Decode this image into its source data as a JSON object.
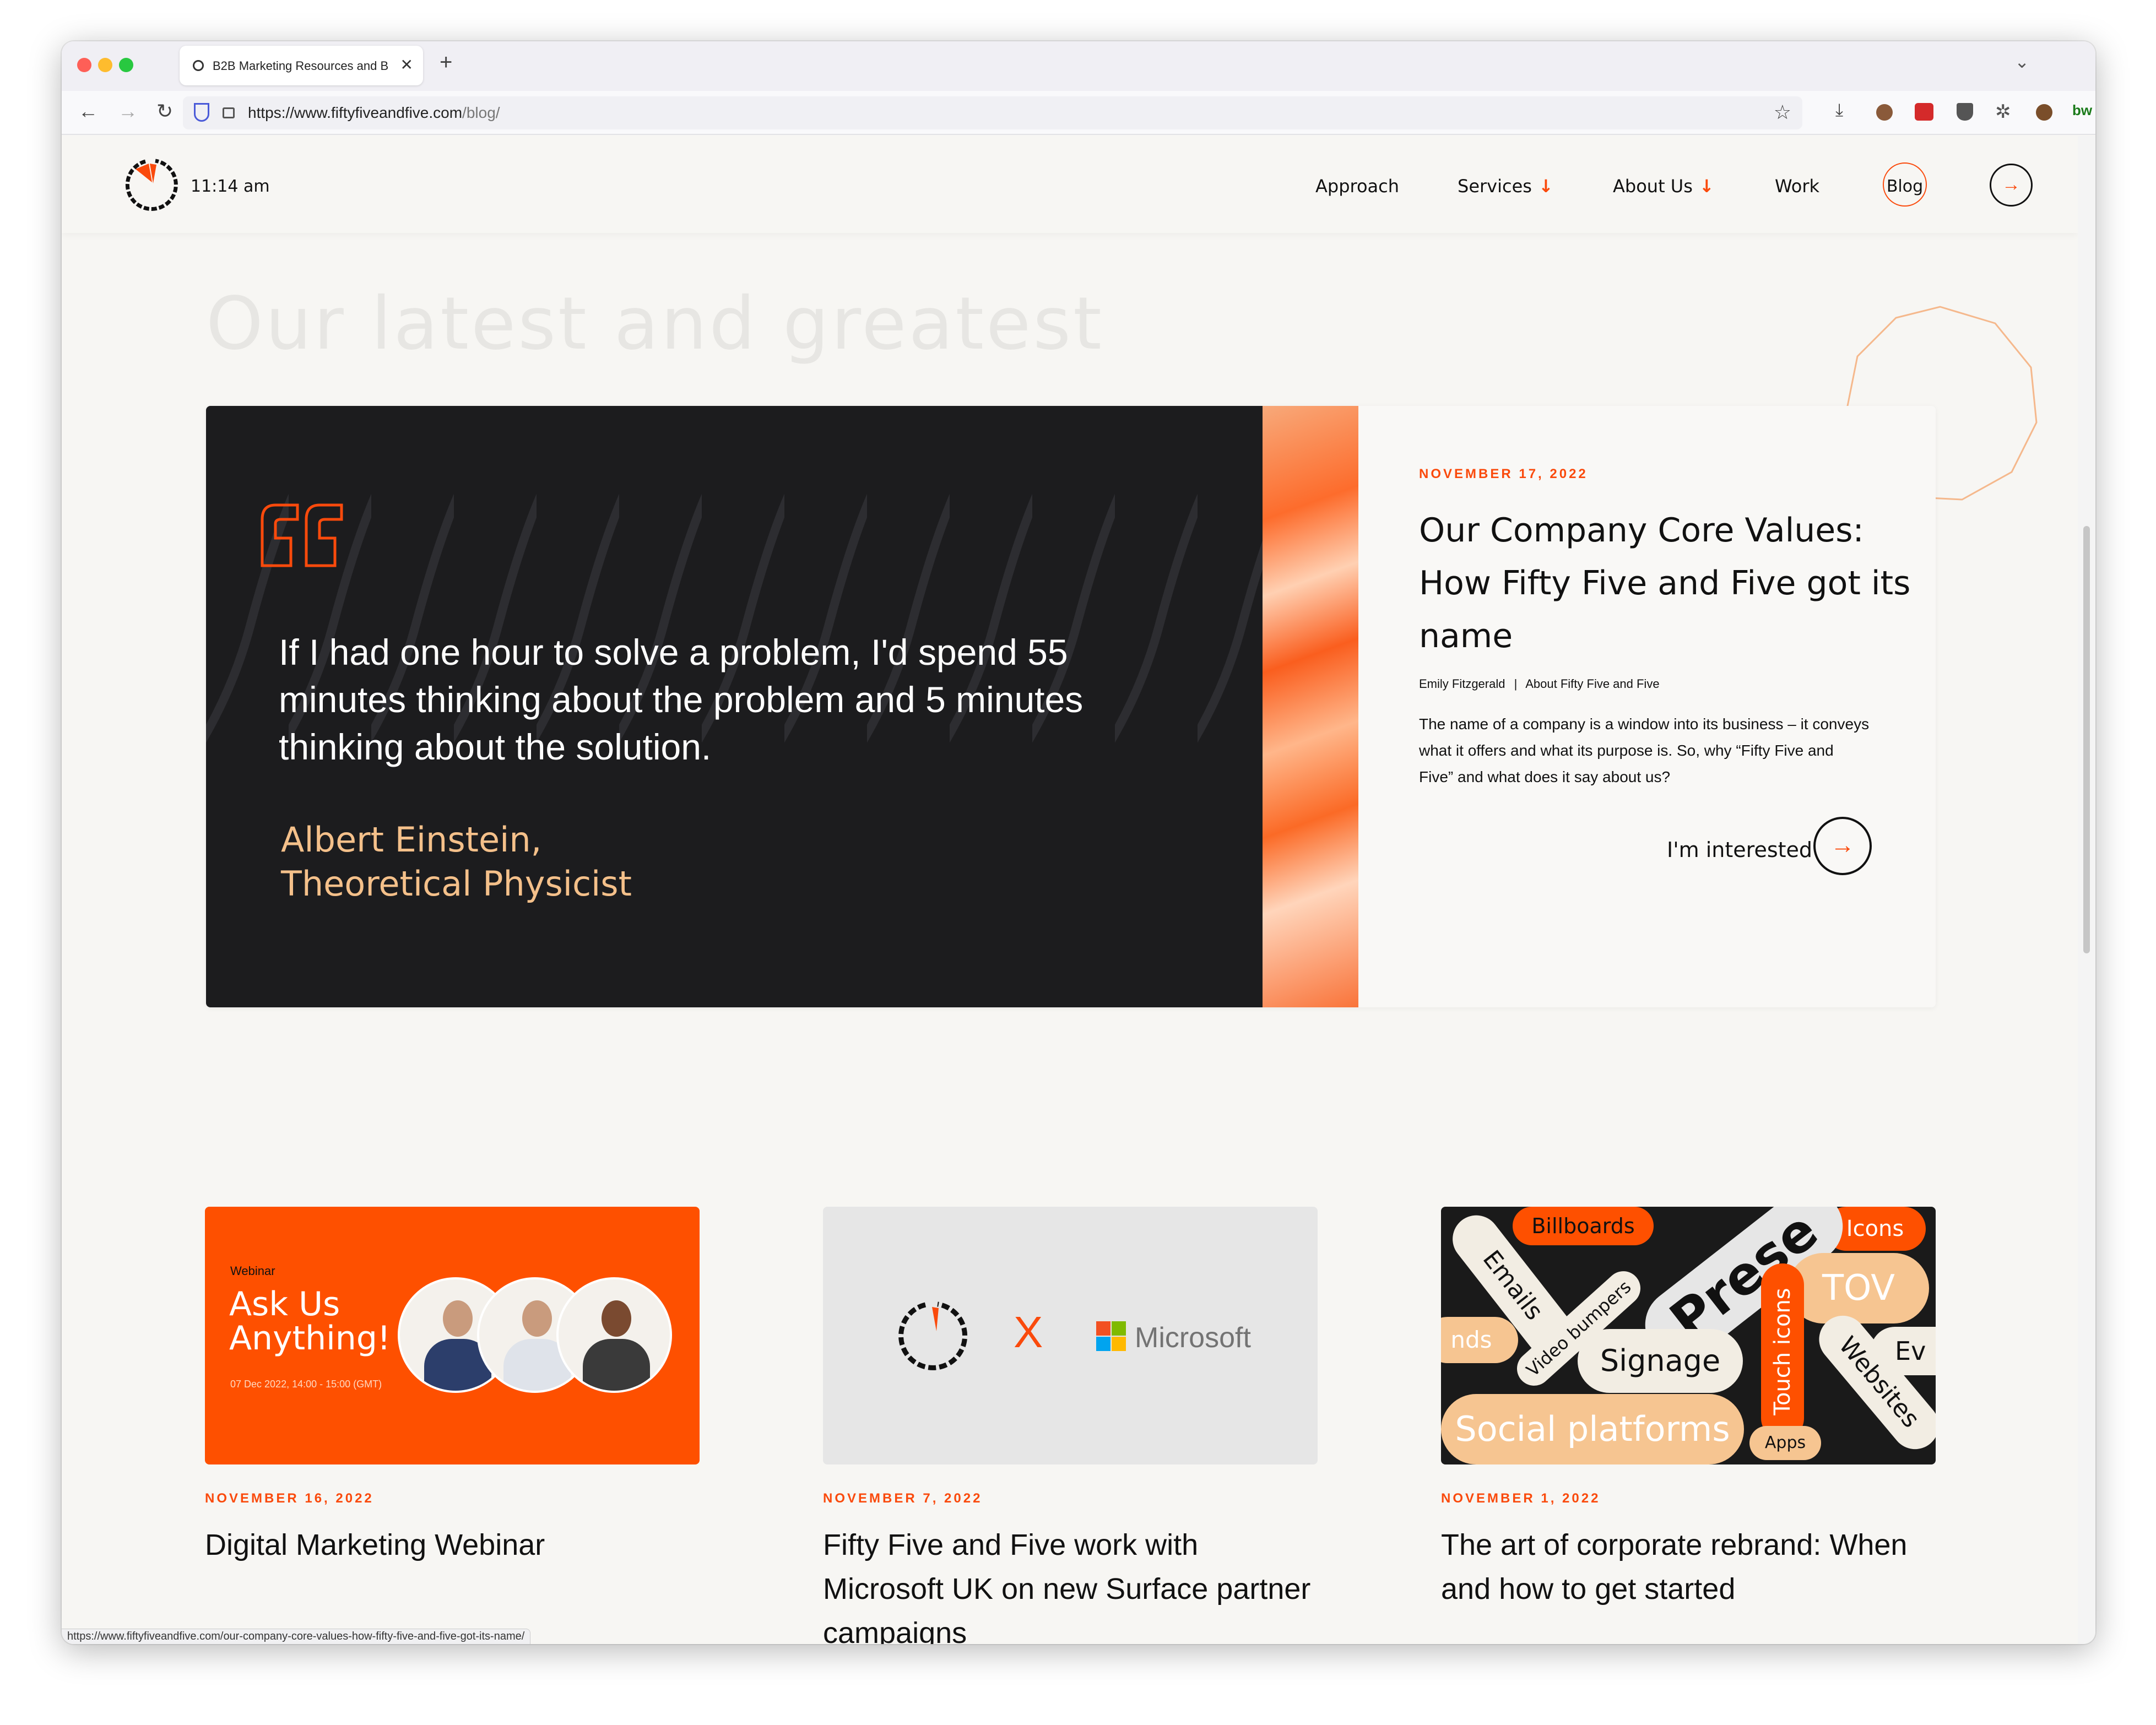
{
  "browser": {
    "tab_title": "B2B Marketing Resources and B",
    "url_domain": "https://www.fiftyfiveandfive.com",
    "url_path": "/blog/",
    "status_url": "https://www.fiftyfiveandfive.com/our-company-core-values-how-fifty-five-and-five-got-its-name/"
  },
  "header": {
    "time": "11:14 am",
    "nav": [
      "Approach",
      "Services",
      "About Us",
      "Work",
      "Blog"
    ],
    "dropdown_arrow": "↓",
    "cta_arrow": "→"
  },
  "page": {
    "background_title": "Our latest and greatest"
  },
  "hero": {
    "quote": "If I had one hour to solve a problem, I'd spend 55 minutes thinking about the problem and 5 minutes thinking about the solution.",
    "author_name": "Albert Einstein,",
    "author_role": "Theoretical Physicist",
    "date": "NOVEMBER 17, 2022",
    "title": "Our Company Core Values: How Fifty Five and Five got its name",
    "author": "Emily Fitzgerald",
    "meta_separator": "|",
    "category": "About Fifty Five and Five",
    "excerpt": "The name of a company is a window into its business – it conveys what it offers and what its purpose is. So, why “Fifty Five and Five” and what does it say about us?",
    "cta": "I'm interested",
    "cta_arrow": "→"
  },
  "posts": [
    {
      "date": "NOVEMBER 16, 2022",
      "title": "Digital Marketing Webinar",
      "thumb": {
        "tag": "Webinar",
        "line1": "Ask Us",
        "line2": "Anything!",
        "when": "07 Dec 2022, 14:00 - 15:00 (GMT)"
      }
    },
    {
      "date": "NOVEMBER 7, 2022",
      "title": "Fifty Five and Five work with Microsoft UK on new Surface partner campaigns",
      "thumb": {
        "x": "X",
        "brand": "Microsoft"
      }
    },
    {
      "date": "NOVEMBER 1, 2022",
      "title": "The art of corporate rebrand: When and how to get started",
      "thumb": {
        "words": [
          "Billboards",
          "Icons",
          "Emails",
          "Prese",
          "TOV",
          "nds",
          "Video bumpers",
          "Signage",
          "Touch icons",
          "Ev",
          "Websites",
          "Social platforms",
          "Apps"
        ]
      }
    }
  ],
  "colors": {
    "accent": "#fa4a0c",
    "dark": "#1c1c1e",
    "gold": "#f4c08a"
  }
}
